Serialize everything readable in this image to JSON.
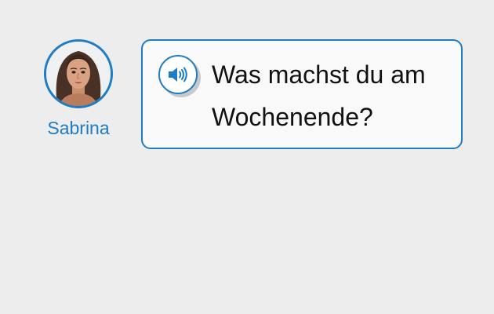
{
  "speaker": {
    "name": "Sabrina",
    "avatar_icon": "person-portrait-icon"
  },
  "prompt": {
    "text": "Was machst du am Wochenende?",
    "audio_icon": "speaker-volume-icon"
  },
  "colors": {
    "accent": "#1d7cc4",
    "background": "#ededed",
    "bubble_background": "#f9f9f9",
    "text": "#111111"
  }
}
